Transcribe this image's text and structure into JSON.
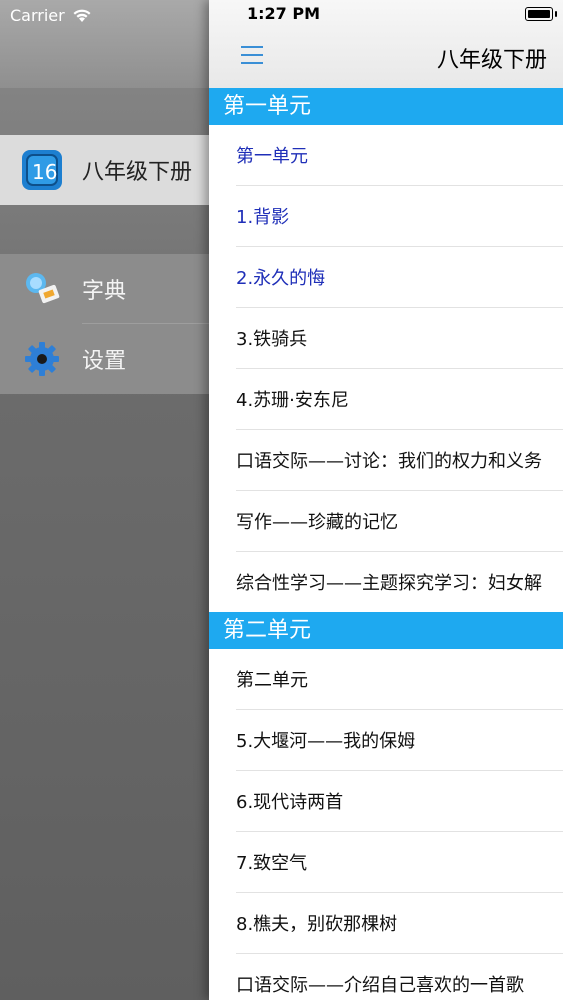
{
  "status": {
    "carrier": "Carrier",
    "time": "1:27 PM"
  },
  "drawer": {
    "items": [
      {
        "label": "八年级下册",
        "icon": "book-app-icon"
      },
      {
        "label": "字典",
        "icon": "dictionary-icon"
      },
      {
        "label": "设置",
        "icon": "gear-icon"
      }
    ]
  },
  "navbar": {
    "title": "八年级下册"
  },
  "sections": [
    {
      "header": "第一单元",
      "items": [
        {
          "label": "第一单元",
          "selected": true
        },
        {
          "label": "1.背影",
          "selected": true
        },
        {
          "label": "2.永久的悔",
          "selected": true
        },
        {
          "label": "3.铁骑兵"
        },
        {
          "label": "4.苏珊·安东尼"
        },
        {
          "label": "口语交际——讨论：我们的权力和义务"
        },
        {
          "label": "写作——珍藏的记忆"
        },
        {
          "label": "综合性学习——主题探究学习：妇女解"
        }
      ]
    },
    {
      "header": "第二单元",
      "items": [
        {
          "label": "第二单元"
        },
        {
          "label": "5.大堰河——我的保姆"
        },
        {
          "label": "6.现代诗两首"
        },
        {
          "label": "7.致空气"
        },
        {
          "label": "8.樵夫，别砍那棵树"
        },
        {
          "label": "口语交际——介绍自己喜欢的一首歌"
        }
      ]
    }
  ],
  "colors": {
    "accent": "#1ea9f0",
    "selected_text": "#1f2fb8",
    "menu_icon": "#3a8fd6"
  }
}
